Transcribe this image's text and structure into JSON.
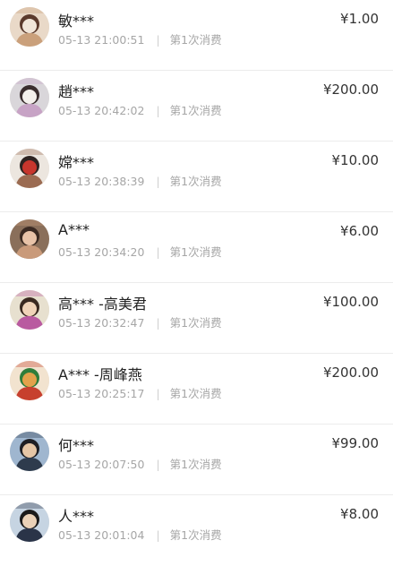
{
  "donations": [
    {
      "name": "敏***",
      "time": "05-13 21:00:51",
      "count": "第1次消费",
      "amount": "¥1.00",
      "avatar": {
        "bg": "#e9d9c8",
        "a": "#caa07b",
        "b": "#5b3a2c",
        "c": "#f1e6d9"
      }
    },
    {
      "name": "趙***",
      "time": "05-13 20:42:02",
      "count": "第1次消费",
      "amount": "¥200.00",
      "avatar": {
        "bg": "#d9d6da",
        "a": "#c7a3c5",
        "b": "#3a2d2e",
        "c": "#f4f0ec"
      }
    },
    {
      "name": "嫦***",
      "time": "05-13 20:38:39",
      "count": "第1次消费",
      "amount": "¥10.00",
      "avatar": {
        "bg": "#ece6df",
        "a": "#9b6b52",
        "b": "#2e2321",
        "c": "#c7362d"
      }
    },
    {
      "name": "A***",
      "time": "05-13 20:34:20",
      "count": "第1次消费",
      "amount": "¥6.00",
      "avatar": {
        "bg": "#8a6f5a",
        "a": "#c99a7a",
        "b": "#3b2a22",
        "c": "#e8c3a8"
      }
    },
    {
      "name": "高*** -高美君",
      "time": "05-13 20:32:47",
      "count": "第1次消费",
      "amount": "¥100.00",
      "avatar": {
        "bg": "#e7e0cf",
        "a": "#b95aa0",
        "b": "#3a2920",
        "c": "#f0d3b8"
      }
    },
    {
      "name": "A*** -周峰燕",
      "time": "05-13 20:25:17",
      "count": "第1次消费",
      "amount": "¥200.00",
      "avatar": {
        "bg": "#f2e3cf",
        "a": "#c7402e",
        "b": "#2f7d3a",
        "c": "#e3a24b"
      }
    },
    {
      "name": "何***",
      "time": "05-13 20:07:50",
      "count": "第1次消费",
      "amount": "¥99.00",
      "avatar": {
        "bg": "#9fb6cf",
        "a": "#2e3b4d",
        "b": "#1f1f24",
        "c": "#e6c6a6"
      }
    },
    {
      "name": "人***",
      "time": "05-13 20:01:04",
      "count": "第1次消费",
      "amount": "¥8.00",
      "avatar": {
        "bg": "#c6d4e2",
        "a": "#2a3448",
        "b": "#1a1a1a",
        "c": "#ead1b7"
      }
    }
  ]
}
